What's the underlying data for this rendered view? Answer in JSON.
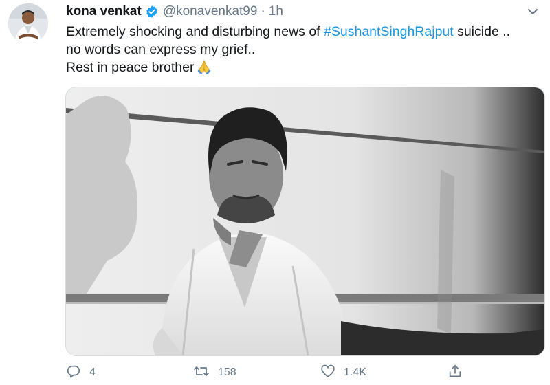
{
  "tweet": {
    "author_name": "kona venkat",
    "handle": "@konavenkat99",
    "separator": "·",
    "time": "1h",
    "text_part1": "Extremely shocking and disturbing news of ",
    "hashtag": "#SushantSinghRajput",
    "text_part2": " suicide ..",
    "line2": "no words can express my grief..",
    "line3": "Rest in peace brother"
  },
  "actions": {
    "replies": "4",
    "retweets": "158",
    "likes": "1.4K"
  },
  "colors": {
    "link": "#1b95e0",
    "verified": "#1da1f2",
    "muted": "#657786"
  },
  "icons": {
    "more": "chevron-down-icon",
    "verified": "verified-badge-icon",
    "emoji": "folded-hands-emoji",
    "reply": "reply-icon",
    "retweet": "retweet-icon",
    "like": "heart-icon",
    "share": "share-icon"
  }
}
